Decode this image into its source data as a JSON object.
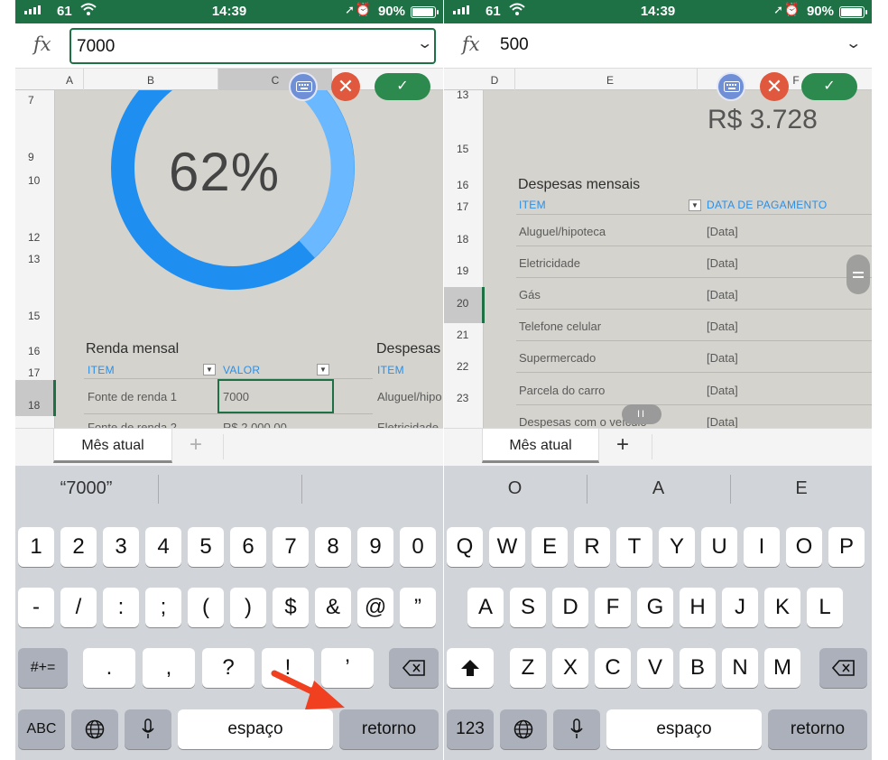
{
  "status_bar": {
    "carrier": "61",
    "time": "14:39",
    "battery": "90%",
    "battery_level": 0.9
  },
  "left": {
    "formula_value": "7000",
    "columns": [
      "A",
      "B",
      "C"
    ],
    "rows": [
      "7",
      "9",
      "10",
      "12",
      "13",
      "15",
      "16",
      "17",
      "18"
    ],
    "donut": {
      "value_label": "62%",
      "percent": 62,
      "colors": {
        "main": "#1f8ef1",
        "rest": "#6ab8ff"
      }
    },
    "income": {
      "title": "Renda mensal",
      "col_item": "ITEM",
      "col_value": "VALOR",
      "rows": [
        {
          "item": "Fonte de renda 1",
          "value": "7000"
        },
        {
          "item": "Fonte de renda 2",
          "value": "R$ 2.000,00"
        }
      ]
    },
    "expenses_peek": {
      "title": "Despesas",
      "col_item": "ITEM",
      "rows": [
        "Aluguel/hipo",
        "Eletricidade"
      ]
    },
    "tab_label": "Mês atual",
    "tab_add": "+",
    "suggestions": [
      "“7000”",
      "",
      ""
    ],
    "keys": {
      "row1": [
        "1",
        "2",
        "3",
        "4",
        "5",
        "6",
        "7",
        "8",
        "9",
        "0"
      ],
      "row2": [
        "-",
        "/",
        ":",
        ";",
        "(",
        ")",
        "$",
        "&",
        "@",
        "”"
      ],
      "row3": [
        ".",
        ",",
        "?",
        "!",
        "’"
      ],
      "symbols": "#+=",
      "abc": "ABC",
      "space": "espaço",
      "return": "retorno"
    }
  },
  "right": {
    "formula_value": "500",
    "columns": [
      "D",
      "E",
      "F"
    ],
    "rows": [
      "13",
      "15",
      "16",
      "17",
      "18",
      "19",
      "20",
      "21",
      "22",
      "23"
    ],
    "balance_value": "R$ 3.728",
    "expenses": {
      "title": "Despesas mensais",
      "col_item": "ITEM",
      "col_date": "DATA DE PAGAMENTO",
      "rows": [
        {
          "item": "Aluguel/hipoteca",
          "date": "[Data]"
        },
        {
          "item": "Eletricidade",
          "date": "[Data]"
        },
        {
          "item": "Gás",
          "date": "[Data]"
        },
        {
          "item": "Telefone celular",
          "date": "[Data]"
        },
        {
          "item": "Supermercado",
          "date": "[Data]"
        },
        {
          "item": "Parcela do carro",
          "date": "[Data]"
        },
        {
          "item": "Despesas com o veículo",
          "date": "[Data]"
        }
      ]
    },
    "tab_label": "Mês atual",
    "tab_add": "+",
    "suggestions": [
      "O",
      "A",
      "E"
    ],
    "keys": {
      "row1": [
        "Q",
        "W",
        "E",
        "R",
        "T",
        "Y",
        "U",
        "I",
        "O",
        "P"
      ],
      "row2": [
        "A",
        "S",
        "D",
        "F",
        "G",
        "H",
        "J",
        "K",
        "L"
      ],
      "row3": [
        "Z",
        "X",
        "C",
        "V",
        "B",
        "N",
        "M"
      ],
      "numbers": "123",
      "space": "espaço",
      "return": "retorno"
    }
  },
  "annotation": {
    "arrow_color": "#f0401f"
  }
}
